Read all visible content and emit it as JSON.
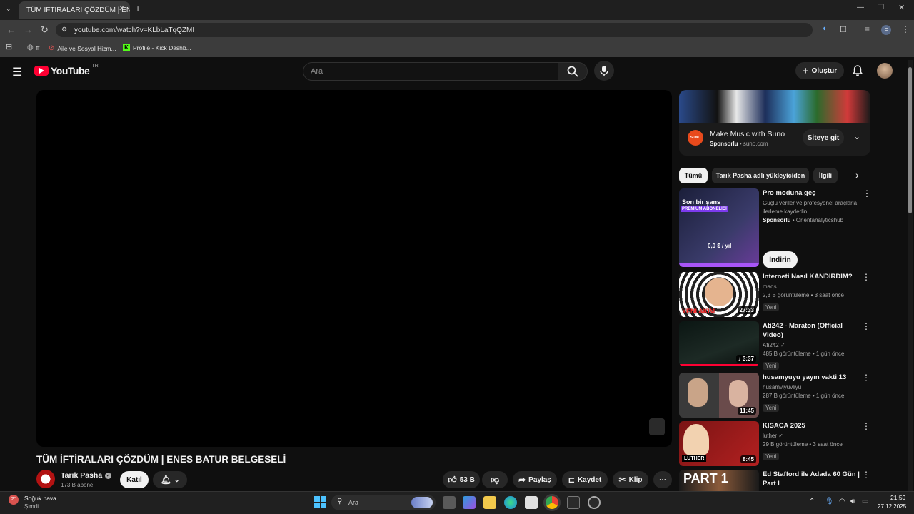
{
  "browser": {
    "tab_title": "TÜM İFTİRALARI ÇÖZDÜM | ENES",
    "url": "youtube.com/watch?v=KLbLaTqQZMI",
    "bookmarks": [
      {
        "label": "ff"
      },
      {
        "label": "Aile ve Sosyal Hizm..."
      },
      {
        "label": "Profile - Kick Dashb..."
      }
    ]
  },
  "youtube": {
    "logo_text": "YouTube",
    "country": "TR",
    "search_placeholder": "Ara",
    "create_label": "Oluştur",
    "video": {
      "title": "TÜM İFTİRALARI ÇÖZDÜM | ENES BATUR BELGESELİ",
      "channel": "Tarık Pasha",
      "subscribers": "173 B abone",
      "join_label": "Katıl",
      "likes": "53 B",
      "share_label": "Paylaş",
      "save_label": "Kaydet",
      "clip_label": "Klip"
    },
    "ad": {
      "title": "Make Music with Suno",
      "sponsored": "Sponsorlu",
      "domain": "suno.com",
      "logo_text": "SUNO",
      "cta": "Siteye git"
    },
    "chips": [
      "Tümü",
      "Tarık Pasha adlı yükleyiciden",
      "İlgili"
    ],
    "sponsored_item": {
      "title": "Pro moduna geç",
      "description": "Güçlü veriler ve profesyonel araçlarla ilerleme kaydedin",
      "sponsored": "Sponsorlu",
      "advertiser": "Orientanalyticshub",
      "cta": "İndirin",
      "thumb_text1": "Son bir şans",
      "thumb_text2": "PREMIUM ABONELİCİ",
      "thumb_text3": "0,0 $ / yıl"
    },
    "recommendations": [
      {
        "title": "İnterneti Nasıl KANDIRDIM?",
        "channel": "maqs",
        "meta": "2,3 B görüntüleme • 3 saat önce",
        "badge": "Yeni",
        "duration": "27:33",
        "thumb_text": "YENİ AKIM",
        "color": "#f3d24a"
      },
      {
        "title": "Ati242 - Maraton (Official Video)",
        "channel": "Ati242",
        "meta": "485 B görüntüleme • 1 gün önce",
        "badge": "Yeni",
        "duration": "3:37",
        "color": "#0e1a18"
      },
      {
        "title": "husamyuyu yayın vakti 13",
        "channel": "husamviyuvliyu",
        "meta": "287 B görüntüleme • 1 gün önce",
        "badge": "Yeni",
        "duration": "11:45",
        "color": "#3a2b2b"
      },
      {
        "title": "KISACA 2025",
        "channel": "luther",
        "meta": "29 B görüntüleme • 3 saat önce",
        "badge": "Yeni",
        "duration": "8:45",
        "thumb_text": "LUTHER",
        "color": "#7a1414"
      },
      {
        "title": "Ed Stafford ile Adada 60 Gün | Part I",
        "channel": "",
        "meta": "",
        "badge": "",
        "duration": "",
        "thumb_text": "PART 1",
        "color": "#1a1a1a"
      }
    ]
  },
  "taskbar": {
    "weather_title": "Soğuk hava",
    "weather_sub": "Şimdi",
    "weather_temp": "2°",
    "search_placeholder": "Ara",
    "time": "21:59",
    "date": "27.12.2025"
  }
}
